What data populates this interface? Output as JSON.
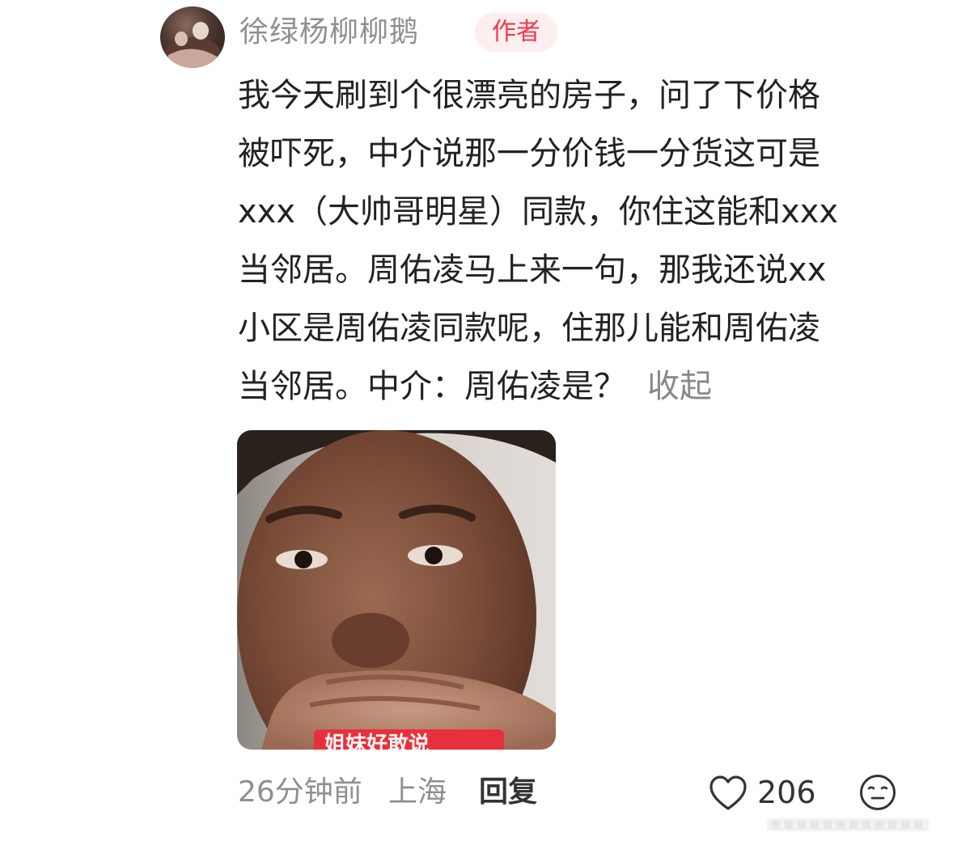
{
  "comment": {
    "username": "徐绿杨柳柳鹅",
    "author_badge": "作者",
    "lines": [
      "我今天刷到个很漂亮的房子，问了下价格",
      "被吓死，中介说那一分价钱一分货这可是",
      "xxx（大帅哥明星）同款，你住这能和xxx",
      "当邻居。周佑凌马上来一句，那我还说xx",
      "小区是周佑凌同款呢，住那儿能和周佑凌",
      "当邻居。中介：周佑凌是？"
    ],
    "collapse_label": "收起",
    "image_caption": "姐妹好敢说"
  },
  "meta": {
    "time": "26分钟前",
    "location": "上海",
    "reply_label": "回复",
    "like_count": "206"
  },
  "icons": {
    "like": "heart-outline-icon",
    "emoji": "neutral-face-icon"
  },
  "colors": {
    "accent": "#ee3b4f",
    "badge_bg": "#fdeef0",
    "muted": "#8f8f8f",
    "text": "#222222"
  }
}
